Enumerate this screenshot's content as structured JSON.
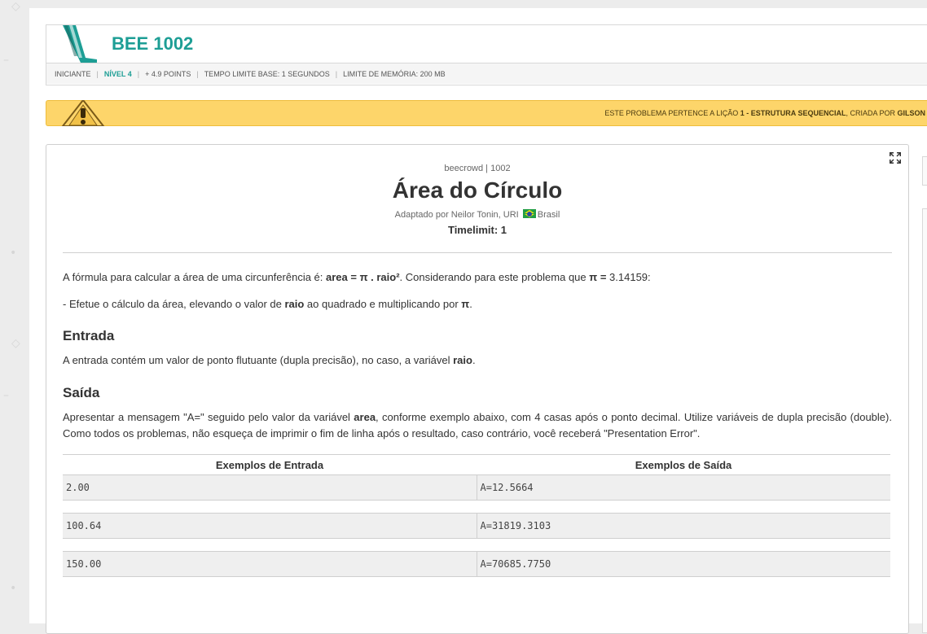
{
  "header": {
    "title": "BEE 1002",
    "meta": {
      "category": "INICIANTE",
      "level": "NÍVEL 4",
      "points": "+ 4.9 POINTS",
      "time_limit": "TEMPO LIMITE BASE: 1 SEGUNDOS",
      "memory_limit": "LIMITE DE MEMÓRIA: 200 MB"
    }
  },
  "banner": {
    "prefix": "ESTE PROBLEMA PERTENCE A LIÇÃO ",
    "lesson": "1 - ESTRUTURA SEQUENCIAL",
    "middle": ", CRIADA POR ",
    "author": "GILSON"
  },
  "problem": {
    "origin": "beecrowd | 1002",
    "title": "Área do Círculo",
    "adapted_prefix": "Adaptado por Neilor Tonin, URI",
    "adapted_country": "Brasil",
    "timelimit": "Timelimit: 1",
    "description": {
      "p1_a": "A fórmula para calcular a área de uma circunferência é: ",
      "p1_b": "area = π . raio²",
      "p1_c": ". Considerando para este problema que ",
      "p1_d": "π = ",
      "p1_e": "3.14159:",
      "p2_a": "- Efetue o cálculo da área, elevando o valor de ",
      "p2_b": "raio",
      "p2_c": " ao quadrado e multiplicando por ",
      "p2_d": "π",
      "p2_e": "."
    },
    "input": {
      "heading": "Entrada",
      "text_a": "A entrada contém um valor de ponto flutuante (dupla precisão), no caso, a variável ",
      "text_b": "raio",
      "text_c": "."
    },
    "output": {
      "heading": "Saída",
      "text_a": "Apresentar a mensagem \"A=\" seguido pelo valor da variável ",
      "text_b": "area",
      "text_c": ", conforme exemplo abaixo, com 4 casas após o ponto decimal. Utilize variáveis de dupla precisão (double). Como todos os problemas, não esqueça de imprimir o fim de linha após o resultado, caso contrário, você receberá \"Presentation Error\"."
    },
    "samples": {
      "input_header": "Exemplos de Entrada",
      "output_header": "Exemplos de Saída",
      "rows": [
        {
          "input": "2.00",
          "output": "A=12.5664"
        },
        {
          "input": "100.64",
          "output": "A=31819.3103"
        },
        {
          "input": "150.00",
          "output": "A=70685.7750"
        }
      ]
    }
  },
  "icons": {
    "expand": "expand-icon",
    "warning": "warning-icon",
    "flag": "brazil-flag-icon"
  },
  "colors": {
    "brand": "#1d9e95",
    "banner": "#fdd56a"
  }
}
